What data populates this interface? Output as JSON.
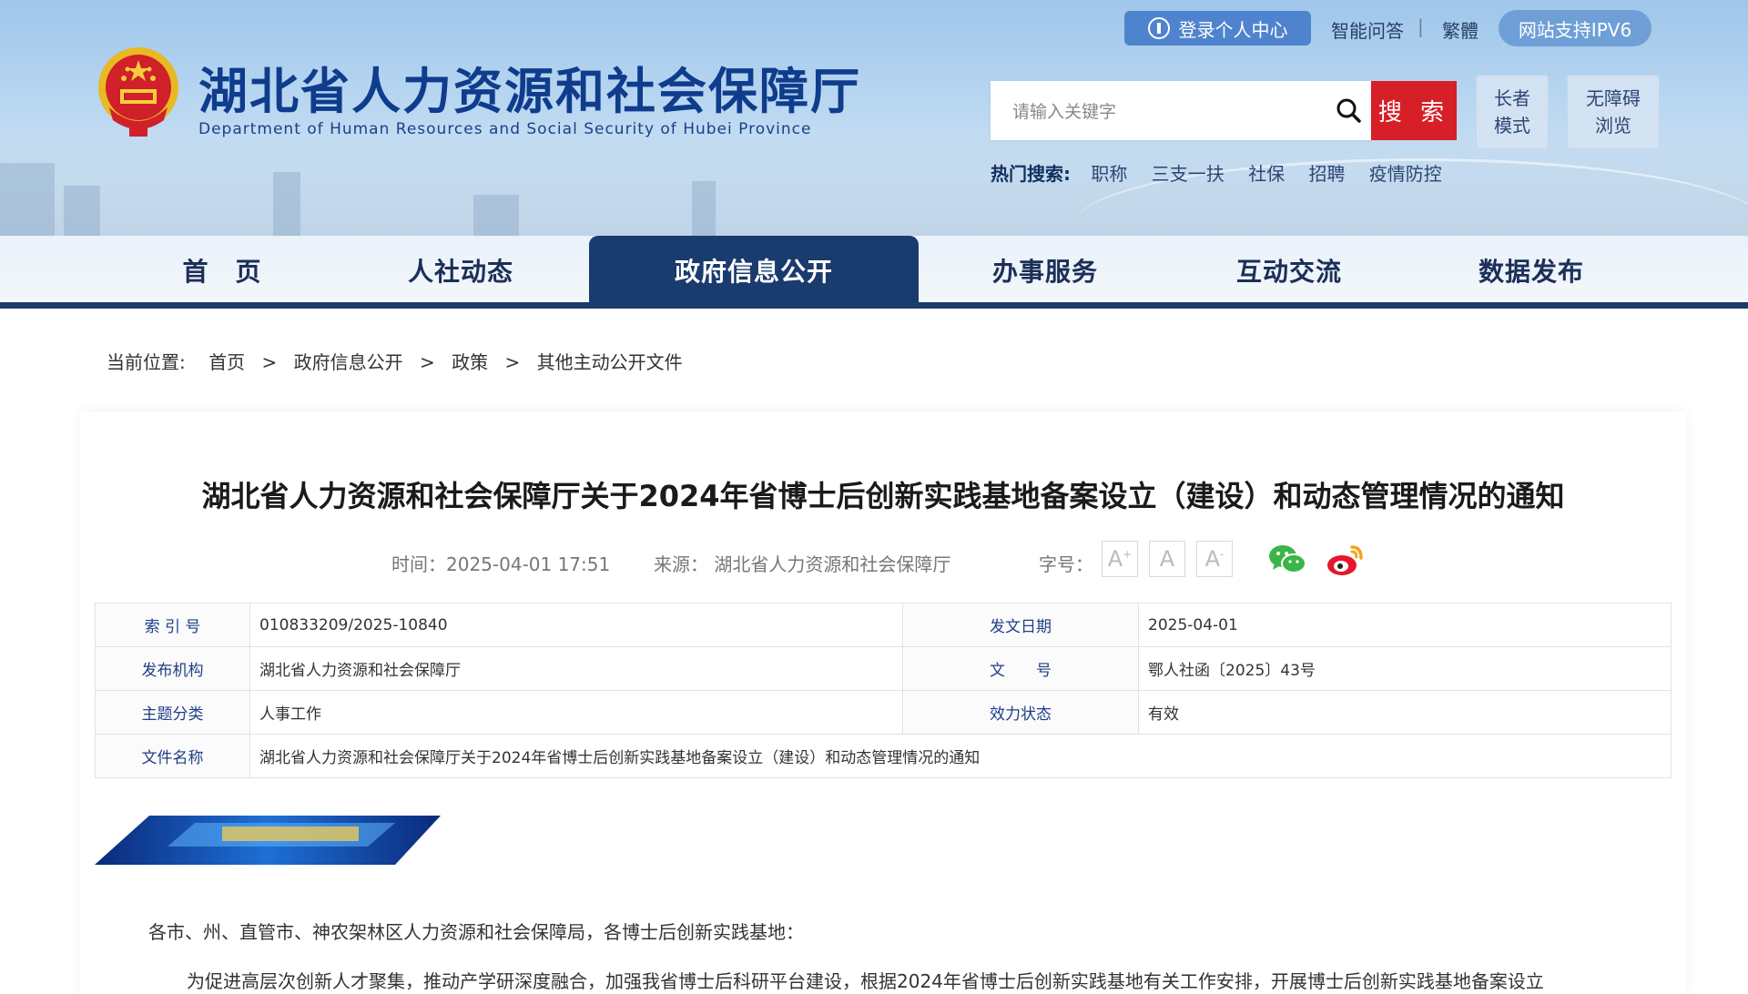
{
  "header": {
    "title": "湖北省人力资源和社会保障厅",
    "subtitle": "Department of Human Resources and Social Security of Hubei Province",
    "login_label": "登录个人中心",
    "links": [
      "智能问答",
      "繁體"
    ],
    "separator": "|",
    "ipv6_label": "网站支持IPV6",
    "search": {
      "placeholder": "请输入关键字",
      "button_label": "搜 索"
    },
    "elder_mode_label": [
      "长者",
      "模式"
    ],
    "accessible_label": [
      "无障碍",
      "浏览"
    ],
    "hot_search": {
      "label": "热门搜索:",
      "items": [
        "职称",
        "三支一扶",
        "社保",
        "招聘",
        "疫情防控"
      ]
    }
  },
  "nav": {
    "items": [
      "首　页",
      "人社动态",
      "政府信息公开",
      "办事服务",
      "互动交流",
      "数据发布"
    ],
    "active_index": 2
  },
  "breadcrumb": {
    "label": "当前位置:",
    "items": [
      "首页",
      "政府信息公开",
      "政策",
      "其他主动公开文件"
    ],
    "separator": ">"
  },
  "article": {
    "title": "湖北省人力资源和社会保障厅关于2024年省博士后创新实践基地备案设立（建设）和动态管理情况的通知",
    "meta": {
      "time": "时间：2025-04-01 17:51",
      "source": "来源： 湖北省人力资源和社会保障厅",
      "font_size_label": "字号：",
      "font_buttons": [
        "A",
        "A",
        "A"
      ]
    },
    "info": {
      "index_label": "索 引 号",
      "index_value": "010833209/2025-10840",
      "date_label": "发文日期",
      "date_value": "2025-04-01",
      "issuer_label": "发布机构",
      "issuer_value": "湖北省人力资源和社会保障厅",
      "docno_label": "文　　号",
      "docno_value": "鄂人社函〔2025〕43号",
      "category_label": "主题分类",
      "category_value": "人事工作",
      "status_label": "效力状态",
      "status_value": "有效",
      "name_label": "文件名称",
      "name_value": "湖北省人力资源和社会保障厅关于2024年省博士后创新实践基地备案设立（建设）和动态管理情况的通知"
    },
    "body": [
      "各市、州、直管市、神农架林区人力资源和社会保障局，各博士后创新实践基地：",
      "为促进高层次创新人才聚集，推动产学研深度融合，加强我省博士后科研平台建设，根据2024年省博士后创新实践基地有关工作安排，开展博士后创新实践基地备案设立"
    ]
  },
  "colors": {
    "brand_blue": "#0f3c8c",
    "nav_active": "#1a3b6d",
    "search_red": "#d71f27"
  }
}
